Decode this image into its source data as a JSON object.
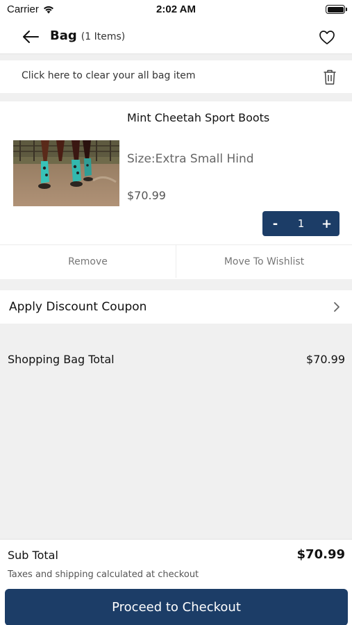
{
  "status_bar": {
    "carrier": "Carrier",
    "time": "2:02 AM"
  },
  "nav": {
    "title": "Bag",
    "item_count": "(1 Items)",
    "back_icon": "arrow-left-icon",
    "wishlist_icon": "heart-outline-icon"
  },
  "clear_bag": {
    "text": "Click here to clear your all bag item",
    "icon": "trash-icon"
  },
  "cart_item": {
    "name": "Mint Cheetah Sport Boots",
    "size": "Size:Extra Small Hind",
    "price": "$70.99",
    "quantity": "1",
    "decrement_label": "-",
    "increment_label": "+",
    "remove_label": "Remove",
    "wishlist_label": "Move To Wishlist"
  },
  "coupon": {
    "label": "Apply Discount Coupon",
    "icon": "chevron-right-icon"
  },
  "bag_total": {
    "label": "Shopping Bag Total",
    "value": "$70.99"
  },
  "footer": {
    "subtotal_label": "Sub Total",
    "subtotal_value": "$70.99",
    "tax_note": "Taxes and shipping calculated at checkout",
    "checkout_label": "Proceed to Checkout"
  },
  "colors": {
    "primary": "#1c3d67",
    "background": "#f0f0f0",
    "surface": "#ffffff"
  }
}
